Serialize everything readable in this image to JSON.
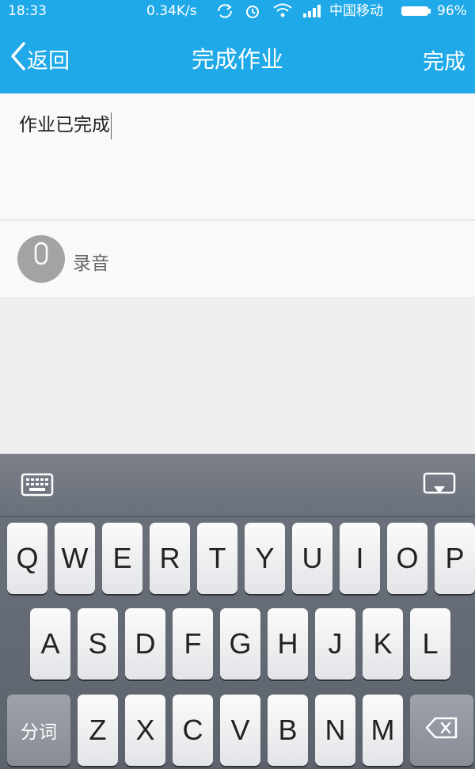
{
  "status_bar": {
    "time": "18:33",
    "speed": "0.34K/s",
    "carrier": "中国移动",
    "battery": "96%"
  },
  "nav": {
    "back_label": "返回",
    "title": "完成作业",
    "done_label": "完成"
  },
  "editor": {
    "text": "作业已完成"
  },
  "voice": {
    "label": "录音"
  },
  "keyboard": {
    "row1": [
      "Q",
      "W",
      "E",
      "R",
      "T",
      "Y",
      "U",
      "I",
      "O",
      "P"
    ],
    "row2": [
      "A",
      "S",
      "D",
      "F",
      "G",
      "H",
      "J",
      "K",
      "L"
    ],
    "row3": [
      "Z",
      "X",
      "C",
      "V",
      "B",
      "N",
      "M"
    ],
    "segment_label": "分词"
  },
  "colors": {
    "accent": "#1fa9e8",
    "keyboard_bg": "#6a707a",
    "key_bg": "#f2f2f4"
  }
}
